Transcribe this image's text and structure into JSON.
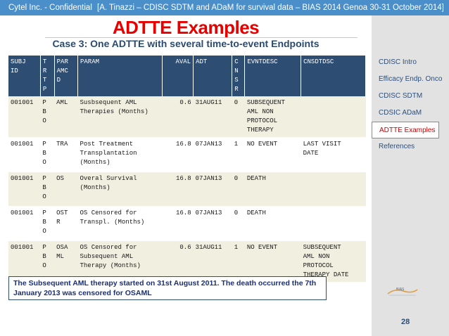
{
  "header": {
    "confidential": "Cytel Inc. - Confidential",
    "reference": "[A. Tinazzi – CDISC SDTM and ADaM for survival data – BIAS 2014 Genoa 30-31 October 2014]"
  },
  "slide": {
    "title": "ADTTE Examples",
    "subtitle": "Case 3: One ADTTE with several time-to-event Endpoints"
  },
  "table": {
    "headers": {
      "subj": [
        "SUBJ",
        "ID"
      ],
      "trt": [
        "T",
        "R",
        "T",
        "P"
      ],
      "parmcd": [
        "PAR",
        "AMC",
        "D"
      ],
      "param": "PARAM",
      "aval": "AVAL",
      "adt": "ADT",
      "cnsr": [
        "C",
        "N",
        "S",
        "R"
      ],
      "evntdesc": "EVNTDESC",
      "cnsdtdsc": "CNSDTDSC"
    },
    "rows": [
      {
        "subj": "001001",
        "trt": [
          "P",
          "B",
          "O"
        ],
        "parmcd": [
          "AML"
        ],
        "param": [
          "Susbsequent AML",
          "Therapies (Months)"
        ],
        "aval": "0.6",
        "adt": "31AUG11",
        "cnsr": "0",
        "evntdesc": [
          "SUBSEQUENT",
          "AML NON",
          "PROTOCOL",
          "THERAPY"
        ],
        "cnsdtdsc": []
      },
      {
        "subj": "001001",
        "trt": [
          "P",
          "B",
          "O"
        ],
        "parmcd": [
          "TRA"
        ],
        "param": [
          "Post Treatment",
          "Transplantation",
          "(Months)"
        ],
        "aval": "16.8",
        "adt": "07JAN13",
        "cnsr": "1",
        "evntdesc": [
          "NO EVENT"
        ],
        "cnsdtdsc": [
          "LAST VISIT",
          "DATE"
        ]
      },
      {
        "subj": "001001",
        "trt": [
          "P",
          "B",
          "O"
        ],
        "parmcd": [
          "OS"
        ],
        "param": [
          "Overal Survival",
          "(Months)"
        ],
        "aval": "16.8",
        "adt": "07JAN13",
        "cnsr": "0",
        "evntdesc": [
          "DEATH"
        ],
        "cnsdtdsc": []
      },
      {
        "subj": "001001",
        "trt": [
          "P",
          "B",
          "O"
        ],
        "parmcd": [
          "OST",
          "R"
        ],
        "param": [
          "OS Censored for",
          "Transpl. (Months)"
        ],
        "aval": "16.8",
        "adt": "07JAN13",
        "cnsr": "0",
        "evntdesc": [
          "DEATH"
        ],
        "cnsdtdsc": []
      },
      {
        "subj": "001001",
        "trt": [
          "P",
          "B",
          "O"
        ],
        "parmcd": [
          "OSA",
          "ML"
        ],
        "param": [
          "OS Censored for",
          "Subsequent AML",
          "Therapy (Months)"
        ],
        "aval": "0.6",
        "adt": "31AUG11",
        "cnsr": "1",
        "evntdesc": [
          "NO EVENT"
        ],
        "cnsdtdsc": [
          "SUBSEQUENT",
          "AML NON",
          "PROTOCOL",
          "THERAPY DATE"
        ]
      }
    ]
  },
  "nav": {
    "items": [
      {
        "label": "CDISC Intro",
        "active": false
      },
      {
        "label": "Efficacy Endp. Onco",
        "active": false
      },
      {
        "label": "CDISC SDTM",
        "active": false
      },
      {
        "label": "CDSIC ADaM",
        "active": false
      },
      {
        "label": "ADTTE Examples",
        "active": true
      },
      {
        "label": "References",
        "active": false
      }
    ]
  },
  "note": "The Subsequent AML therapy started on 31st August 2011. The death occurred the 7th January 2013 was censored for OSAML",
  "logo": {
    "text": "BIAS"
  },
  "page_number": "28",
  "colors": {
    "header_bar": "#4a8eca",
    "title": "#e60000",
    "table_header": "#2d4d73",
    "sidebar": "#e2e2e2",
    "active_nav": "#cc0000"
  }
}
